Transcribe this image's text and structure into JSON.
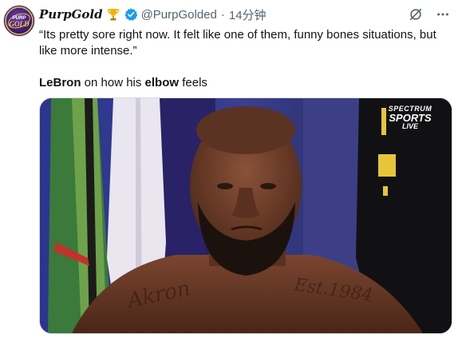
{
  "author": {
    "display_name": "PurpGold",
    "handle": "@PurpGolded",
    "separator": "·",
    "timestamp": "14分钟",
    "badge_emoji": "trophy",
    "avatar_text": "PURP GOLD"
  },
  "actions": {
    "grok_icon": "grok-icon",
    "more_icon": "more-icon"
  },
  "tweet": {
    "quote": "“Its pretty sore right now. It felt like one of them, funny bones situations, but like more intense.”",
    "caption_name": "LeBron",
    "caption_mid": " on how his ",
    "caption_word": "elbow",
    "caption_end": " feels"
  },
  "media": {
    "watermark_line1": "SPECTRUM",
    "watermark_line2": "SPORTS",
    "watermark_line3": "LIVE",
    "tattoo_left": "Akron",
    "tattoo_right": "Est.1984"
  },
  "colors": {
    "verified": "#1d9bf0",
    "secondary_text": "#536471",
    "background_purple": "#2a2f6e"
  }
}
